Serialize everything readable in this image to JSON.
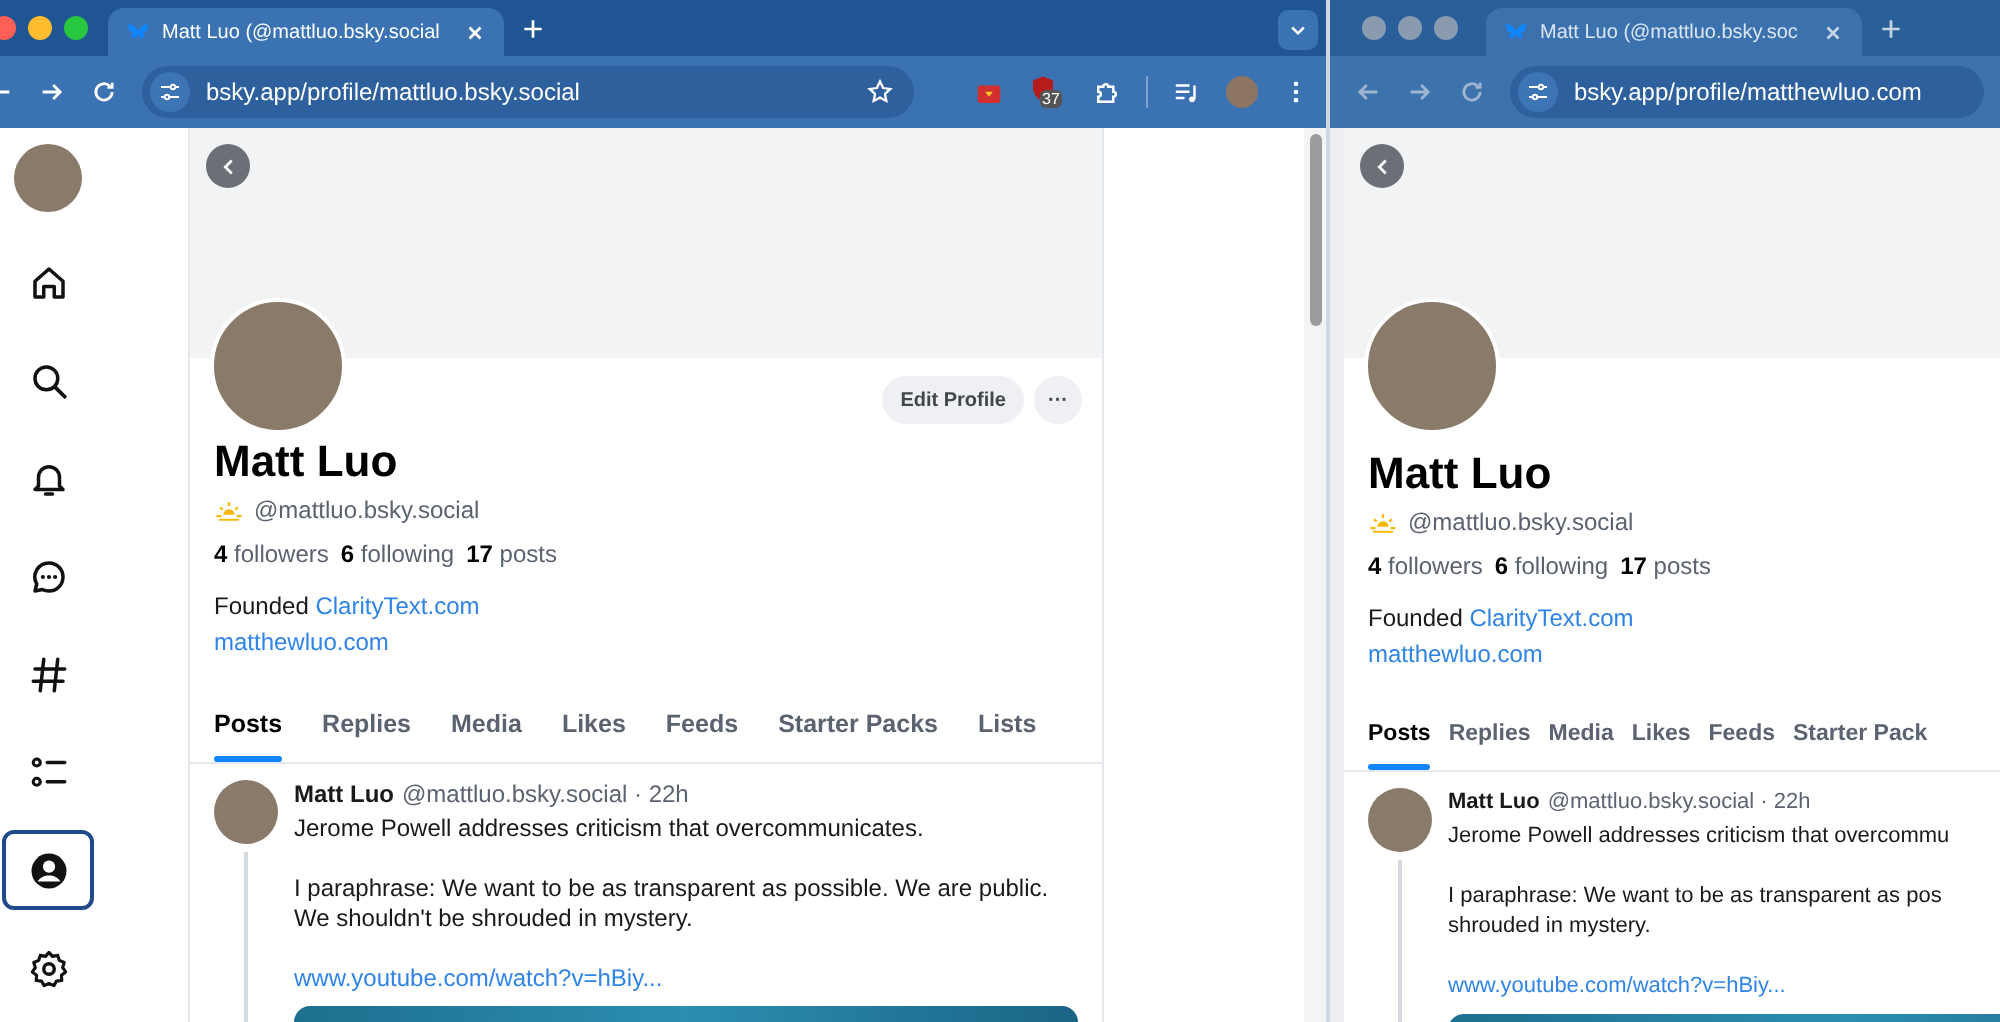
{
  "windows": [
    {
      "focused": true,
      "tab_title": "Matt Luo (@mattluo.bsky.social",
      "address": "bsky.app/profile/mattluo.bsky.social",
      "extension_badge": "37",
      "sidebar": [
        {
          "kind": "avatar",
          "selected": false
        },
        {
          "kind": "home",
          "selected": false
        },
        {
          "kind": "search",
          "selected": false
        },
        {
          "kind": "notifications",
          "selected": false
        },
        {
          "kind": "chat",
          "selected": false
        },
        {
          "kind": "feeds",
          "selected": false
        },
        {
          "kind": "lists",
          "selected": false
        },
        {
          "kind": "profile",
          "selected": true
        },
        {
          "kind": "settings",
          "selected": false
        }
      ],
      "profile": {
        "name": "Matt Luo",
        "handle": "@mattluo.bsky.social",
        "edit_button": "Edit Profile",
        "more_button": "···",
        "stats": [
          {
            "count": "4",
            "label": "followers"
          },
          {
            "count": "6",
            "label": "following"
          },
          {
            "count": "17",
            "label": "posts"
          }
        ],
        "bio_prefix": "Founded",
        "bio_link": "ClarityText.com",
        "website": "matthewluo.com",
        "tabs": [
          {
            "label": "Posts",
            "selected": true
          },
          {
            "label": "Replies",
            "selected": false
          },
          {
            "label": "Media",
            "selected": false
          },
          {
            "label": "Likes",
            "selected": false
          },
          {
            "label": "Feeds",
            "selected": false
          },
          {
            "label": "Starter Packs",
            "selected": false
          },
          {
            "label": "Lists",
            "selected": false
          }
        ],
        "post": {
          "author": "Matt Luo",
          "meta": "@mattluo.bsky.social · 22h",
          "paragraphs": [
            [
              "Jerome Powell addresses criticism that overcommunicates."
            ],
            [
              "I paraphrase: We want to be as transparent as possible. We are public.",
              "We shouldn't be shrouded in mystery."
            ]
          ],
          "link": "www.youtube.com/watch?v=hBiy..."
        }
      }
    },
    {
      "focused": false,
      "tab_title": "Matt Luo (@mattluo.bsky.soc",
      "address": "bsky.app/profile/matthewluo.com",
      "profile": {
        "name": "Matt Luo",
        "handle": "@mattluo.bsky.social",
        "stats": [
          {
            "count": "4",
            "label": "followers"
          },
          {
            "count": "6",
            "label": "following"
          },
          {
            "count": "17",
            "label": "posts"
          }
        ],
        "bio_prefix": "Founded",
        "bio_link": "ClarityText.com",
        "website": "matthewluo.com",
        "tabs": [
          {
            "label": "Posts",
            "selected": true
          },
          {
            "label": "Replies",
            "selected": false
          },
          {
            "label": "Media",
            "selected": false
          },
          {
            "label": "Likes",
            "selected": false
          },
          {
            "label": "Feeds",
            "selected": false
          },
          {
            "label": "Starter Pack",
            "selected": false
          }
        ],
        "post": {
          "author": "Matt Luo",
          "meta": "@mattluo.bsky.social · 22h",
          "paragraphs": [
            [
              "Jerome Powell addresses criticism that overcommu"
            ],
            [
              "I paraphrase: We want to be as transparent as pos",
              "shrouded in mystery."
            ]
          ],
          "link": "www.youtube.com/watch?v=hBiy..."
        }
      }
    }
  ]
}
